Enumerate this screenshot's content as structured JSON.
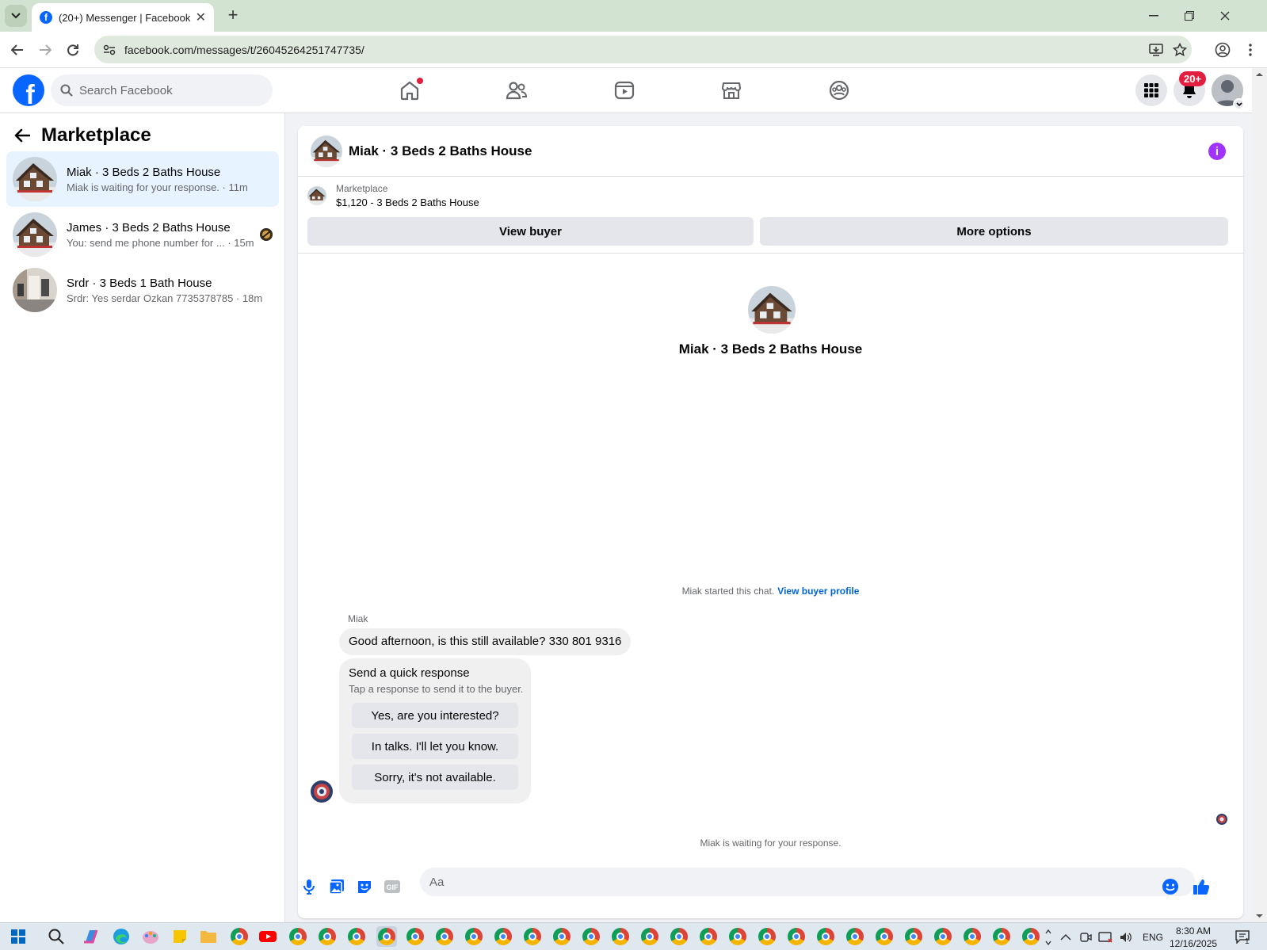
{
  "browser": {
    "tab_title": "(20+) Messenger | Facebook",
    "url": "facebook.com/messages/t/26045264251747735/",
    "new_tab_label": "+",
    "tab_close_label": "✕"
  },
  "fb_header": {
    "logo_letter": "f",
    "search_placeholder": "Search Facebook",
    "notification_badge": "20+",
    "nav_icons": [
      "home-icon",
      "friends-icon",
      "video-icon",
      "marketplace-icon",
      "groups-icon"
    ]
  },
  "sidebar": {
    "title": "Marketplace",
    "conversations": [
      {
        "name": "Miak · 3 Beds 2 Baths House",
        "preview": "Miak is waiting for your response. · 11m",
        "active": true
      },
      {
        "name": "James · 3 Beds 2 Baths House",
        "preview": "You: send me phone number for ... · 15m",
        "active": false
      },
      {
        "name": "Srdr · 3 Beds 1 Bath House",
        "preview": "Srdr: Yes serdar Ozkan 7735378785 · 18m",
        "active": false
      }
    ]
  },
  "chat": {
    "title": "Miak · 3 Beds 2 Baths House",
    "listing_source": "Marketplace",
    "listing_price_title": "$1,120 - 3 Beds 2 Baths House",
    "view_buyer_label": "View buyer",
    "more_options_label": "More options",
    "profile_name": "Miak · 3 Beds 2 Baths House",
    "started_text": "Miak started this chat.",
    "view_profile_link": "View buyer profile",
    "sender_name": "Miak",
    "message_text": "Good afternoon, is this still available? 330 801 9316",
    "quick_response": {
      "title": "Send a quick response",
      "subtitle": "Tap a response to send it to the buyer.",
      "options": [
        "Yes, are you interested?",
        "In talks. I'll let you know.",
        "Sorry, it's not available."
      ]
    },
    "waiting_text": "Miak is waiting for your response.",
    "composer_placeholder": "Aa"
  },
  "taskbar": {
    "language": "ENG",
    "time": "8:30 AM",
    "date": "12/16/2025",
    "notification_count": "1"
  },
  "colors": {
    "fb_blue": "#0866ff",
    "link_blue": "#0064d1",
    "badge_red": "#e41e3f",
    "info_purple": "#a033ff",
    "active_row": "#e7f3ff"
  }
}
